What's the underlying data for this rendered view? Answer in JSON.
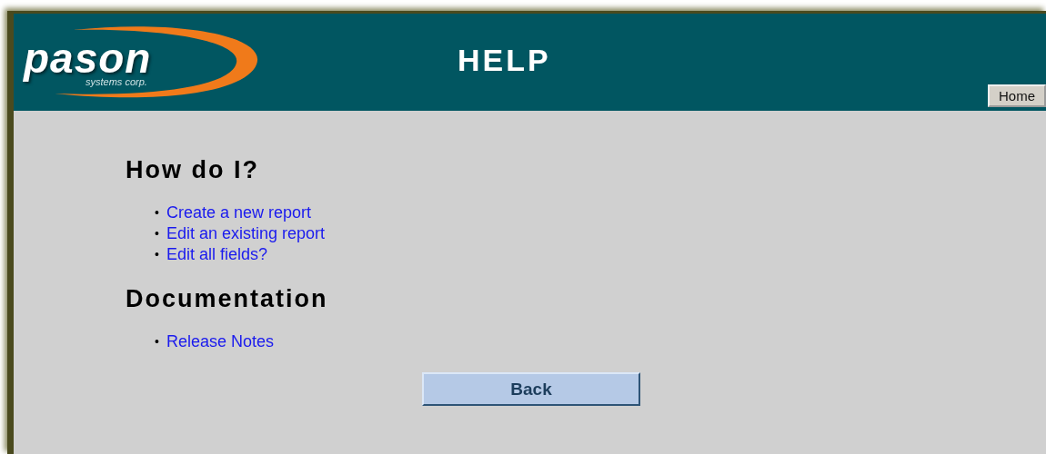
{
  "logo": {
    "name": "pason",
    "tagline": "systems corp."
  },
  "header": {
    "title": "HELP",
    "home_button": "Home"
  },
  "sections": [
    {
      "heading": "How do I?",
      "links": [
        {
          "bullet": "•",
          "text": "Create a new report"
        },
        {
          "bullet": "•",
          "text": "Edit an existing report"
        },
        {
          "bullet": "•",
          "text": "Edit all fields?"
        }
      ]
    },
    {
      "heading": "Documentation",
      "links": [
        {
          "bullet": "•",
          "text": "Release Notes"
        }
      ]
    }
  ],
  "back_button": "Back"
}
